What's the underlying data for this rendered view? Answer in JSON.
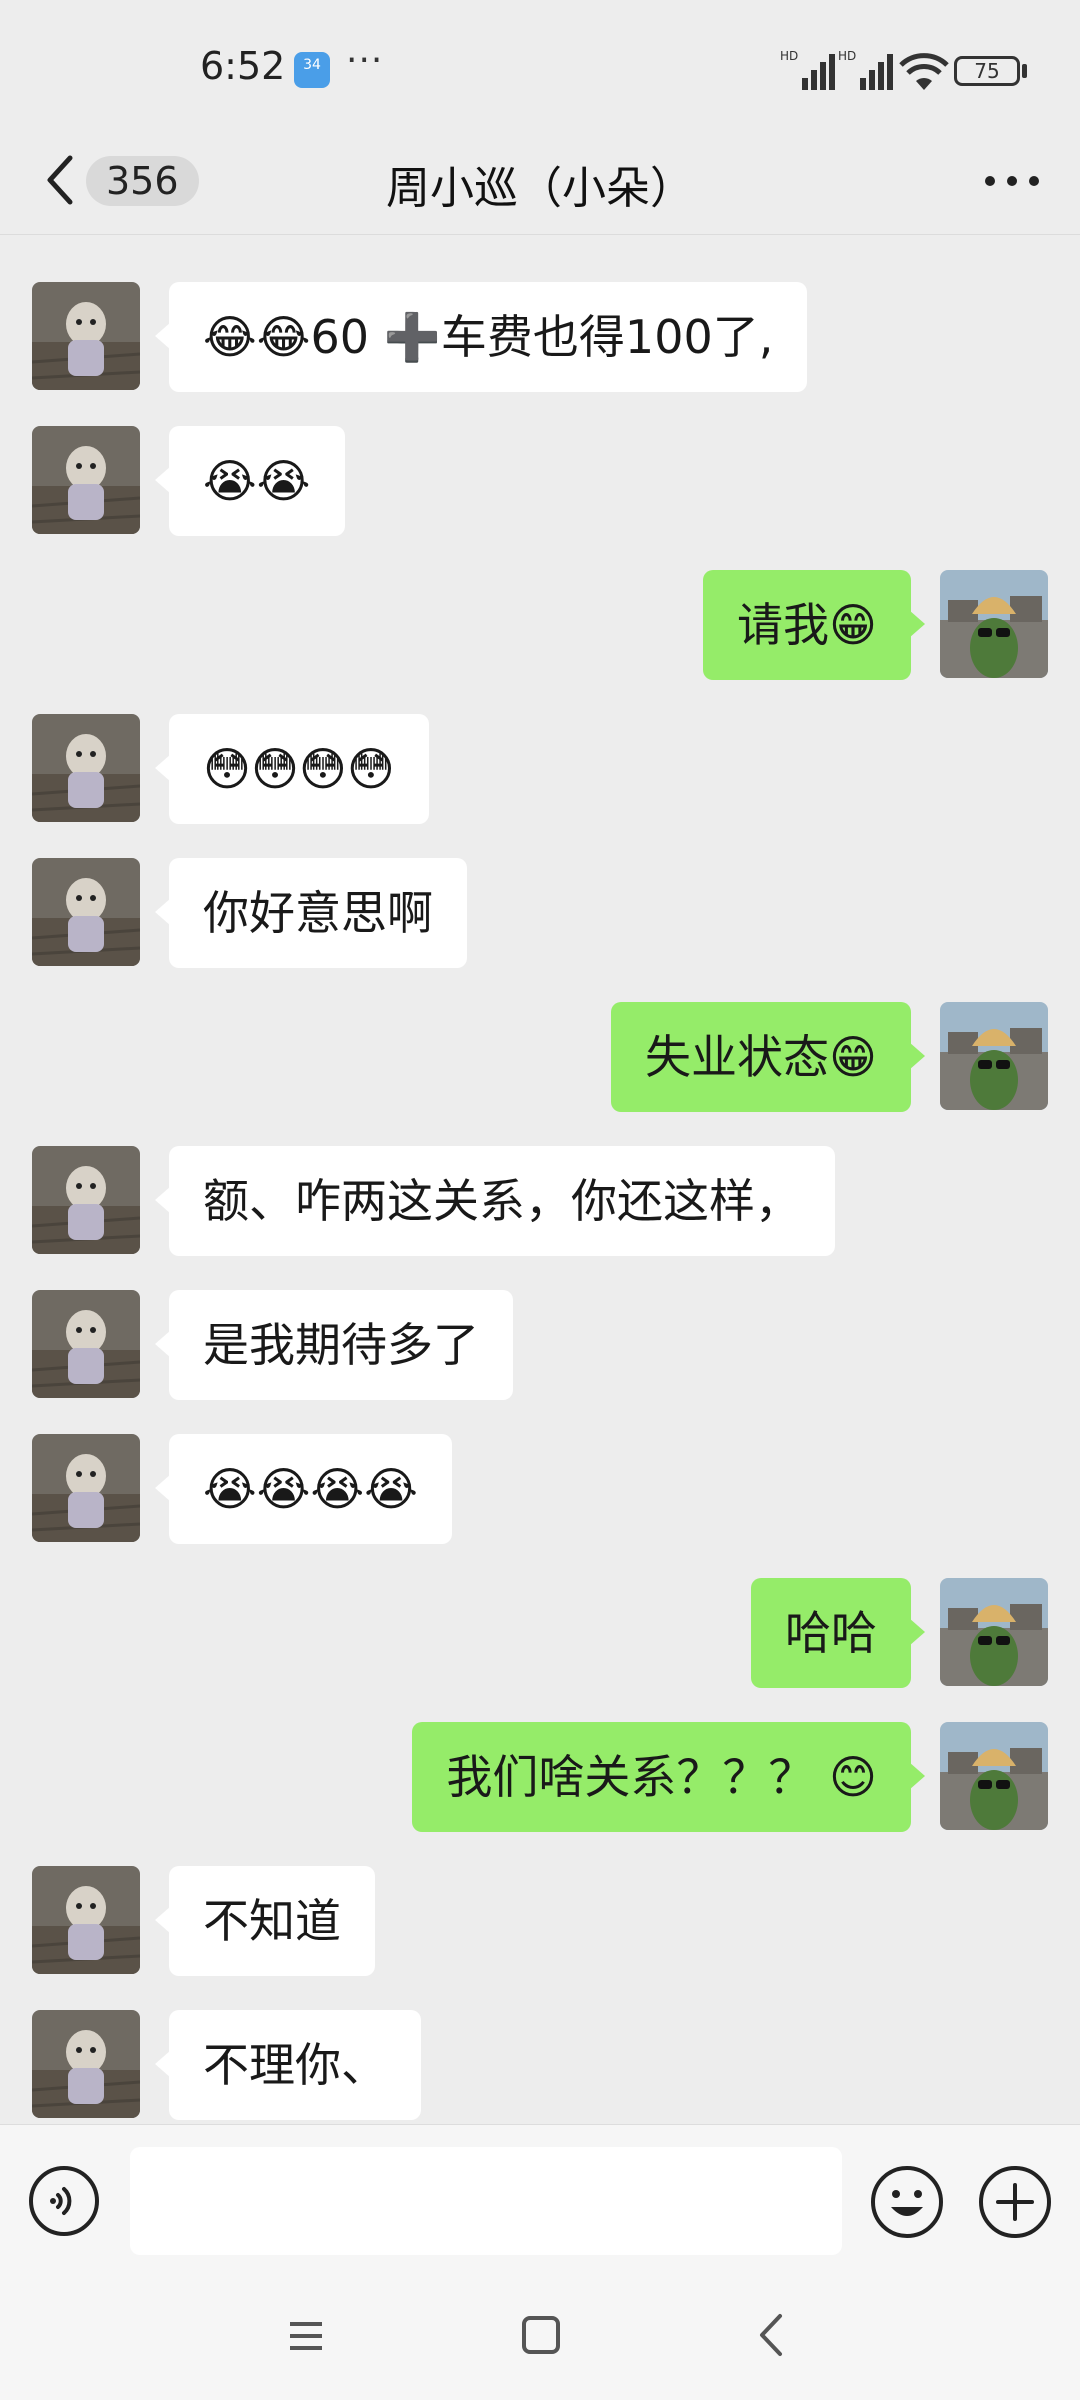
{
  "status_bar": {
    "time": "6:52",
    "app_icon_text": "34",
    "more": "···",
    "signal1_label": "HD",
    "signal2_label": "HD",
    "battery": "75"
  },
  "header": {
    "back_icon": "chevron-left-icon",
    "unread_count": "356",
    "title": "周小巡（小朵）",
    "more_icon": "more-horizontal-icon"
  },
  "messages": [
    {
      "side": "left",
      "text": "😂😂60 ➕车费也得100了,"
    },
    {
      "side": "left",
      "text": "😭😭"
    },
    {
      "side": "right",
      "text": "请我😁"
    },
    {
      "side": "left",
      "text": "😳😳😳😳"
    },
    {
      "side": "left",
      "text": "你好意思啊"
    },
    {
      "side": "right",
      "text": "失业状态😁"
    },
    {
      "side": "left",
      "text": "额、咋两这关系，你还这样，"
    },
    {
      "side": "left",
      "text": "是我期待多了"
    },
    {
      "side": "left",
      "text": "😭😭😭😭"
    },
    {
      "side": "right",
      "text": "哈哈"
    },
    {
      "side": "right",
      "text": "我们啥关系？？？ 😊"
    },
    {
      "side": "left",
      "text": "不知道"
    },
    {
      "side": "left",
      "text": "不理你、"
    }
  ],
  "input_bar": {
    "voice_icon": "voice-icon",
    "input_value": "",
    "emoji_icon": "emoji-icon",
    "plus_icon": "plus-icon"
  },
  "nav": {
    "menu_icon": "menu-icon",
    "home_icon": "home-icon",
    "back_icon": "back-icon"
  },
  "colors": {
    "background": "#ededed",
    "own_bubble": "#95ec69",
    "other_bubble": "#ffffff"
  }
}
